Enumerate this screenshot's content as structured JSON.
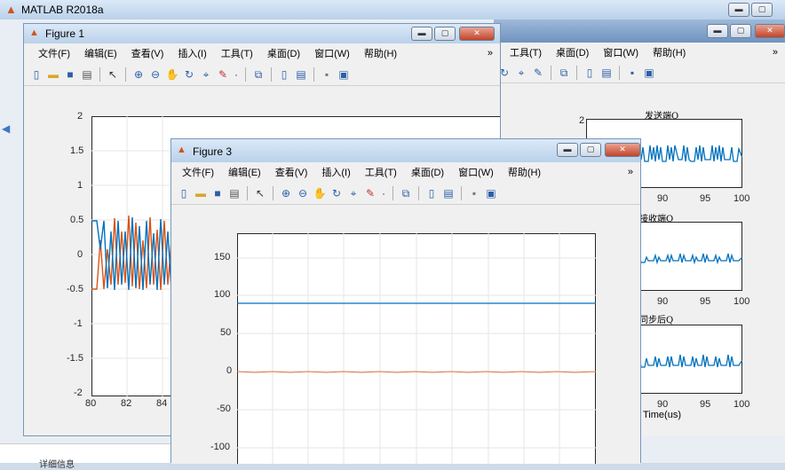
{
  "main_window": {
    "title": "MATLAB R2018a"
  },
  "menu": [
    "文件(F)",
    "编辑(E)",
    "查看(V)",
    "插入(I)",
    "工具(T)",
    "桌面(D)",
    "窗口(W)",
    "帮助(H)"
  ],
  "figure1": {
    "title": "Figure 1",
    "yticks": [
      "2",
      "1.5",
      "1",
      "0.5",
      "0",
      "-0.5",
      "-1",
      "-1.5",
      "-2"
    ],
    "xticks": [
      "80",
      "82",
      "84"
    ]
  },
  "figure3": {
    "title": "Figure 3",
    "yticks": [
      "150",
      "100",
      "50",
      "0",
      "-50",
      "-100"
    ]
  },
  "figure2": {
    "menu": [
      "工具(T)",
      "桌面(D)",
      "窗口(W)",
      "帮助(H)"
    ],
    "plot1_title": "发送端Q",
    "plot2_title": "接收端Q",
    "plot3_title": "同步后Q",
    "ytick_top": "2",
    "xticks": [
      "90",
      "95",
      "100"
    ],
    "xlabel": "Time(us)"
  },
  "status": {
    "text": "详细信息"
  },
  "colors": {
    "blue": "#0072bd",
    "red": "#d95319",
    "line_blue": "#5b9bd5"
  }
}
